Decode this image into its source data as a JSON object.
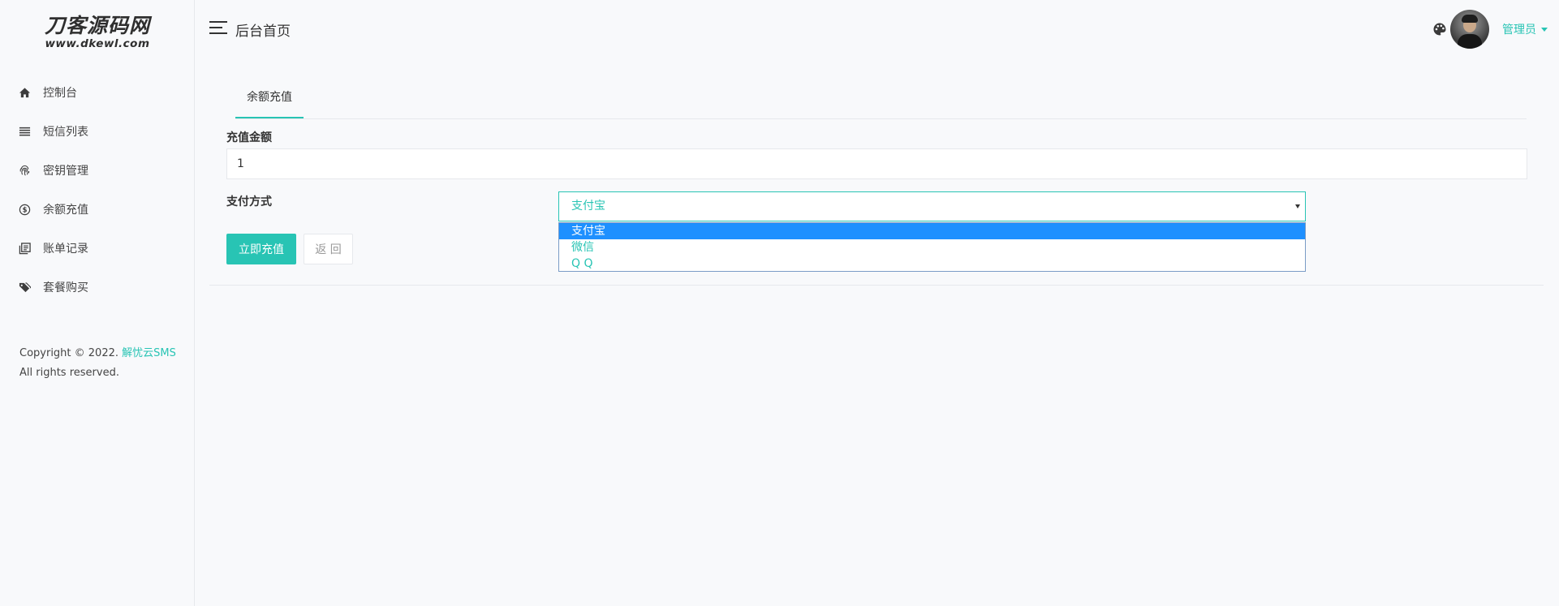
{
  "logo": {
    "title": "刀客源码网",
    "subtitle": "www.dkewl.com"
  },
  "sidebar": {
    "items": [
      {
        "label": "控制台",
        "icon": "home-icon"
      },
      {
        "label": "短信列表",
        "icon": "list-icon"
      },
      {
        "label": "密钥管理",
        "icon": "fingerprint-icon"
      },
      {
        "label": "余额充值",
        "icon": "dollar-circle-icon"
      },
      {
        "label": "账单记录",
        "icon": "book-icon"
      },
      {
        "label": "套餐购买",
        "icon": "tags-icon"
      }
    ],
    "copyright_prefix": "Copyright © 2022.",
    "copyright_brand": "解忧云SMS",
    "copyright_suffix": "All rights reserved."
  },
  "header": {
    "page_title": "后台首页",
    "user_label": "管理员",
    "palette_icon": "palette-icon",
    "menu_icon": "menu-icon"
  },
  "tabs": [
    {
      "label": "余额充值",
      "active": true
    }
  ],
  "form": {
    "amount_label": "充值金额",
    "amount_value": "1",
    "payment_label": "支付方式",
    "payment_selected": "支付宝",
    "payment_options": [
      "支付宝",
      "微信",
      "Q Q"
    ],
    "submit_label": "立即充值",
    "back_label": "返 回"
  },
  "colors": {
    "accent": "#28c4b4",
    "selection": "#1e90ff",
    "background": "#f8f9fb"
  }
}
